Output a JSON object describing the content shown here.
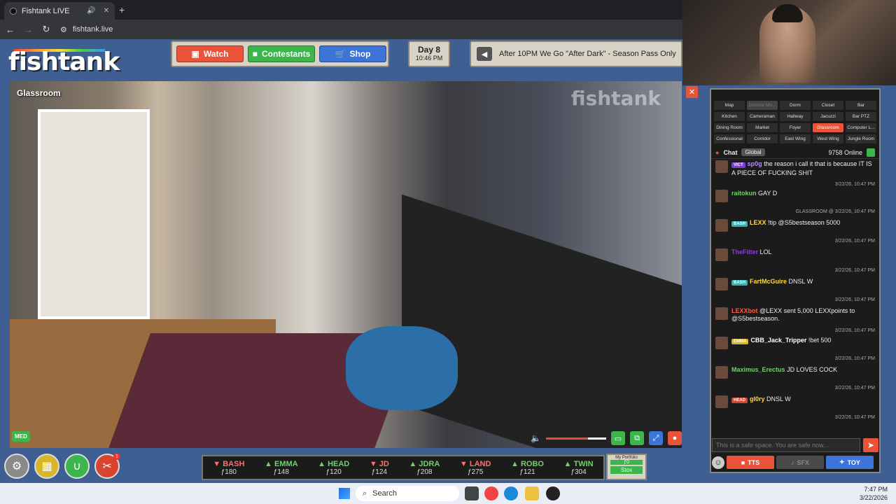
{
  "browser": {
    "tab_title": "Fishtank LIVE",
    "url": "fishtank.live"
  },
  "header": {
    "logo": "fishtank",
    "nav": {
      "watch": "Watch",
      "contestants": "Contestants",
      "shop": "Shop"
    },
    "day": "Day 8",
    "time": "10:46 PM",
    "ticker": "After 10PM We Go \"After Dark\" - Season Pass Only"
  },
  "video": {
    "camera_label": "Glassroom",
    "watermark": "fishtank",
    "volume_percent": 70,
    "badge": "MED"
  },
  "stocks": [
    {
      "name": "BASH",
      "dir": "dn",
      "value": "ƒ180"
    },
    {
      "name": "EMMA",
      "dir": "up",
      "value": "ƒ148"
    },
    {
      "name": "HEAD",
      "dir": "up",
      "value": "ƒ120"
    },
    {
      "name": "JD",
      "dir": "dn",
      "value": "ƒ124"
    },
    {
      "name": "JDRA",
      "dir": "up",
      "value": "ƒ208"
    },
    {
      "name": "LAND",
      "dir": "dn",
      "value": "ƒ275"
    },
    {
      "name": "ROBO",
      "dir": "up",
      "value": "ƒ121"
    },
    {
      "name": "TWIN",
      "dir": "up",
      "value": "ƒ304"
    }
  ],
  "portfolio": {
    "label": "My Portfolio",
    "amount": "ƒ0",
    "button": "Stox"
  },
  "rooms": [
    {
      "label": "Map",
      "state": ""
    },
    {
      "label": "Director Mo...",
      "state": "dim"
    },
    {
      "label": "Dorm",
      "state": ""
    },
    {
      "label": "Closet",
      "state": ""
    },
    {
      "label": "Bar",
      "state": ""
    },
    {
      "label": "Kitchen",
      "state": ""
    },
    {
      "label": "Cameraman",
      "state": ""
    },
    {
      "label": "Hallway",
      "state": ""
    },
    {
      "label": "Jacuzzi",
      "state": ""
    },
    {
      "label": "Bar PTZ",
      "state": ""
    },
    {
      "label": "Dining Room",
      "state": ""
    },
    {
      "label": "Market",
      "state": ""
    },
    {
      "label": "Foyer",
      "state": ""
    },
    {
      "label": "Glassroom",
      "state": "sel"
    },
    {
      "label": "Computer L...",
      "state": ""
    },
    {
      "label": "Confessional",
      "state": ""
    },
    {
      "label": "Corridor",
      "state": ""
    },
    {
      "label": "East Wing",
      "state": ""
    },
    {
      "label": "West Wing",
      "state": ""
    },
    {
      "label": "Jungle Room",
      "state": ""
    }
  ],
  "chat": {
    "title": "Chat",
    "scope": "Global",
    "online": "9758 Online",
    "messages": [
      {
        "tag": "VICT",
        "tag_color": "#7a3dd8",
        "user": "sp0g",
        "user_color": "#b48cff",
        "text": "the reason i call it that is because IT IS A PIECE OF FUCKING SHIT",
        "ts": "3/22/26, 10:47 PM"
      },
      {
        "tag": "",
        "tag_color": "",
        "user": "raitokun",
        "user_color": "#6fd36a",
        "text": "GAY D",
        "ts": "GLASSROOM @ 3/22/26, 10:47 PM"
      },
      {
        "tag": "BASH",
        "tag_color": "#2bb5b5",
        "user": "LEXX",
        "user_color": "#ffd94a",
        "text": "!tip @S5bestseason 5000",
        "ts": "3/22/26, 10:47 PM"
      },
      {
        "tag": "",
        "tag_color": "",
        "user": "TheFilter",
        "user_color": "#8a3dd8",
        "text": "LOL",
        "ts": "3/22/26, 10:47 PM"
      },
      {
        "tag": "BASH",
        "tag_color": "#2bb5b5",
        "user": "FartMcGuire",
        "user_color": "#ffd94a",
        "text": "DNSL W",
        "ts": "3/22/26, 10:47 PM"
      },
      {
        "tag": "",
        "tag_color": "",
        "user": "LEXXbot",
        "user_color": "#ff5a3c",
        "text": "@LEXX sent 5,000 LEXXpoints to @S5bestseason.",
        "ts": "3/22/26, 10:47 PM"
      },
      {
        "tag": "EMMA",
        "tag_color": "#d9b52a",
        "user": "CBB_Jack_Tripper",
        "user_color": "#ffffff",
        "text": "!bet 500",
        "ts": "3/22/26, 10:47 PM"
      },
      {
        "tag": "",
        "tag_color": "",
        "user": "Maximus_Erectus",
        "user_color": "#6fd36a",
        "text": "JD LOVES COCK",
        "ts": "3/22/26, 10:47 PM"
      },
      {
        "tag": "HEAD",
        "tag_color": "#d9442e",
        "user": "gl0ry",
        "user_color": "#ffd94a",
        "text": "DNSL W",
        "ts": "3/22/26, 10:47 PM"
      }
    ],
    "input_placeholder": "This is a safe space. You are safe now...",
    "buttons": {
      "tts": "TTS",
      "sfx": "SFX",
      "toy": "TOY"
    }
  },
  "taskbar": {
    "search": "Search",
    "time": "7:47 PM",
    "date": "3/22/2026"
  }
}
